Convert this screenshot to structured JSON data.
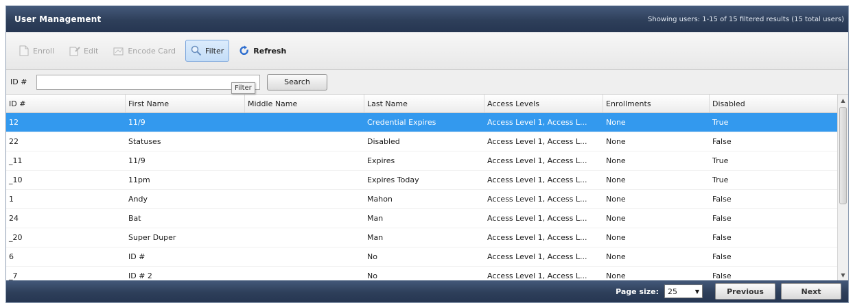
{
  "window": {
    "title": "User Management",
    "status": "Showing users: 1-15 of 15 filtered results (15 total users)"
  },
  "toolbar": {
    "enroll_label": "Enroll",
    "edit_label": "Edit",
    "encode_label": "Encode Card",
    "filter_label": "Filter",
    "refresh_label": "Refresh",
    "filter_tooltip": "Filter"
  },
  "search": {
    "label": "ID #",
    "value": "",
    "button_label": "Search"
  },
  "table": {
    "columns": [
      "ID #",
      "First Name",
      "Middle Name",
      "Last Name",
      "Access Levels",
      "Enrollments",
      "Disabled"
    ],
    "rows": [
      [
        "12",
        "11/9",
        "",
        "Credential Expires",
        "Access Level 1, Access L...",
        "None",
        "True"
      ],
      [
        "22",
        "Statuses",
        "",
        "Disabled",
        "Access Level 1, Access L...",
        "None",
        "False"
      ],
      [
        "_11",
        "11/9",
        "",
        "Expires",
        "Access Level 1, Access L...",
        "None",
        "True"
      ],
      [
        "_10",
        "11pm",
        "",
        "Expires Today",
        "Access Level 1, Access L...",
        "None",
        "True"
      ],
      [
        "1",
        "Andy",
        "",
        "Mahon",
        "Access Level 1, Access L...",
        "None",
        "False"
      ],
      [
        "24",
        "Bat",
        "",
        "Man",
        "Access Level 1, Access L...",
        "None",
        "False"
      ],
      [
        "_20",
        "Super Duper",
        "",
        "Man",
        "Access Level 1, Access L...",
        "None",
        "False"
      ],
      [
        "6",
        "ID #",
        "",
        "No",
        "Access Level 1, Access L...",
        "None",
        "False"
      ],
      [
        "_7",
        "ID # 2",
        "",
        "No",
        "Access Level 1, Access L...",
        "None",
        "False"
      ]
    ],
    "selected_row": 0
  },
  "pager": {
    "page_size_label": "Page size:",
    "page_size_value": "25",
    "previous_label": "Previous",
    "next_label": "Next"
  },
  "colors": {
    "header_bg": "#2e3f5a",
    "selection": "#3399ee",
    "refresh_icon": "#2f6fcf"
  }
}
